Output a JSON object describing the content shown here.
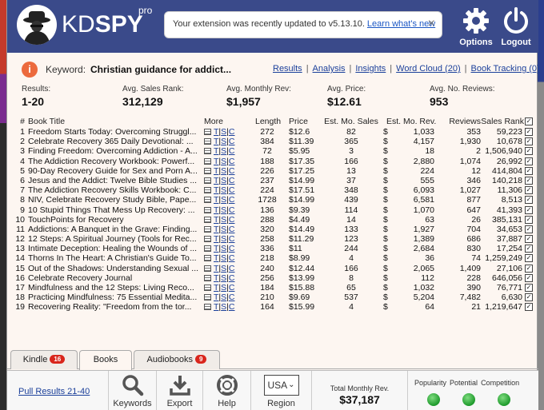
{
  "header": {
    "logo_text_a": "KD",
    "logo_text_b": "SPY",
    "logo_pro": "pro",
    "notice_text": "Your extension was recently updated to v5.13.10.",
    "notice_link": "Learn what's new",
    "notice_close": "×",
    "options_label": "Options",
    "logout_label": "Logout"
  },
  "keyword": {
    "info_glyph": "i",
    "label": "Keyword:",
    "value": "Christian guidance for addict...",
    "links": [
      "Results",
      "Analysis",
      "Insights",
      "Word Cloud (20)",
      "Book Tracking (0)"
    ],
    "separator": "|"
  },
  "stats": [
    {
      "label": "Results:",
      "value": "1-20"
    },
    {
      "label": "Avg. Sales Rank:",
      "value": "312,129"
    },
    {
      "label": "Avg. Monthly Rev:",
      "value": "$1,957"
    },
    {
      "label": "Avg. Price:",
      "value": "$12.61"
    },
    {
      "label": "Avg. No. Reviews:",
      "value": "953"
    }
  ],
  "table": {
    "headers": {
      "num": "#",
      "title": "Book Title",
      "more": "More",
      "length": "Length",
      "price": "Price",
      "sales": "Est. Mo. Sales",
      "rev": "Est. Mo. Rev.",
      "reviews": "Reviews",
      "rank": "Sales Rank"
    },
    "more_links": {
      "t": "T",
      "s": "S",
      "c": "C",
      "sep": "|"
    },
    "currency": "$",
    "check": "✓",
    "rows": [
      {
        "n": "1",
        "title": "Freedom Starts Today: Overcoming Struggl...",
        "len": "272",
        "price": "$12.6",
        "sales": "82",
        "rev": "1,033",
        "reviews": "353",
        "rank": "59,223"
      },
      {
        "n": "2",
        "title": "Celebrate Recovery 365 Daily Devotional: ...",
        "len": "384",
        "price": "$11.39",
        "sales": "365",
        "rev": "4,157",
        "reviews": "1,930",
        "rank": "10,678"
      },
      {
        "n": "3",
        "title": "Finding Freedom: Overcoming Addiction - A...",
        "len": "72",
        "price": "$5.95",
        "sales": "3",
        "rev": "18",
        "reviews": "2",
        "rank": "1,506,940"
      },
      {
        "n": "4",
        "title": "The Addiction Recovery Workbook: Powerf...",
        "len": "188",
        "price": "$17.35",
        "sales": "166",
        "rev": "2,880",
        "reviews": "1,074",
        "rank": "26,992"
      },
      {
        "n": "5",
        "title": "90-Day Recovery Guide for Sex and Porn A...",
        "len": "226",
        "price": "$17.25",
        "sales": "13",
        "rev": "224",
        "reviews": "12",
        "rank": "414,804"
      },
      {
        "n": "6",
        "title": "Jesus and the Addict: Twelve Bible Studies ...",
        "len": "237",
        "price": "$14.99",
        "sales": "37",
        "rev": "555",
        "reviews": "346",
        "rank": "140,218"
      },
      {
        "n": "7",
        "title": "The Addiction Recovery Skills Workbook: C...",
        "len": "224",
        "price": "$17.51",
        "sales": "348",
        "rev": "6,093",
        "reviews": "1,027",
        "rank": "11,306"
      },
      {
        "n": "8",
        "title": "NIV, Celebrate Recovery Study Bible, Pape...",
        "len": "1728",
        "price": "$14.99",
        "sales": "439",
        "rev": "6,581",
        "reviews": "877",
        "rank": "8,513"
      },
      {
        "n": "9",
        "title": "10 Stupid Things That Mess Up Recovery: ...",
        "len": "136",
        "price": "$9.39",
        "sales": "114",
        "rev": "1,070",
        "reviews": "647",
        "rank": "41,393"
      },
      {
        "n": "10",
        "title": "TouchPoints for Recovery",
        "len": "288",
        "price": "$4.49",
        "sales": "14",
        "rev": "63",
        "reviews": "26",
        "rank": "385,131"
      },
      {
        "n": "11",
        "title": "Addictions: A Banquet in the Grave: Finding...",
        "len": "320",
        "price": "$14.49",
        "sales": "133",
        "rev": "1,927",
        "reviews": "704",
        "rank": "34,653"
      },
      {
        "n": "12",
        "title": "12 Steps: A Spiritual Journey (Tools for Rec...",
        "len": "258",
        "price": "$11.29",
        "sales": "123",
        "rev": "1,389",
        "reviews": "686",
        "rank": "37,887"
      },
      {
        "n": "13",
        "title": "Intimate Deception: Healing the Wounds of ...",
        "len": "336",
        "price": "$11",
        "sales": "244",
        "rev": "2,684",
        "reviews": "830",
        "rank": "17,254"
      },
      {
        "n": "14",
        "title": "Thorns In The Heart: A Christian's Guide To...",
        "len": "218",
        "price": "$8.99",
        "sales": "4",
        "rev": "36",
        "reviews": "74",
        "rank": "1,259,249"
      },
      {
        "n": "15",
        "title": "Out of the Shadows: Understanding Sexual ...",
        "len": "240",
        "price": "$12.44",
        "sales": "166",
        "rev": "2,065",
        "reviews": "1,409",
        "rank": "27,106"
      },
      {
        "n": "16",
        "title": "Celebrate Recovery Journal",
        "len": "256",
        "price": "$13.99",
        "sales": "8",
        "rev": "112",
        "reviews": "228",
        "rank": "646,056"
      },
      {
        "n": "17",
        "title": "Mindfulness and the 12 Steps: Living Reco...",
        "len": "184",
        "price": "$15.88",
        "sales": "65",
        "rev": "1,032",
        "reviews": "390",
        "rank": "76,771"
      },
      {
        "n": "18",
        "title": "Practicing Mindfulness: 75 Essential Medita...",
        "len": "210",
        "price": "$9.69",
        "sales": "537",
        "rev": "5,204",
        "reviews": "7,482",
        "rank": "6,630"
      },
      {
        "n": "19",
        "title": "Recovering Reality: \"Freedom from the tor...",
        "len": "164",
        "price": "$15.99",
        "sales": "4",
        "rev": "64",
        "reviews": "21",
        "rank": "1,219,647"
      }
    ]
  },
  "tabs": [
    {
      "label": "Kindle",
      "badge": "16"
    },
    {
      "label": "Books",
      "badge": ""
    },
    {
      "label": "Audiobooks",
      "badge": "9"
    }
  ],
  "footer": {
    "pull_link": "Pull Results 21-40",
    "keywords_label": "Keywords",
    "export_label": "Export",
    "help_label": "Help",
    "region_value": "USA",
    "region_caret": "⌄",
    "region_label": "Region",
    "total_rev_label": "Total Monthly Rev.",
    "total_rev_value": "$37,187",
    "popularity_label": "Popularity",
    "potential_label": "Potential",
    "competition_label": "Competition"
  },
  "colors": {
    "header_bg": "#3a4a8a",
    "accent_orange": "#ec6a3d",
    "badge_red": "#d9261c",
    "link_blue": "#1a3f9a",
    "indicator_green": "#1e9a2c"
  }
}
